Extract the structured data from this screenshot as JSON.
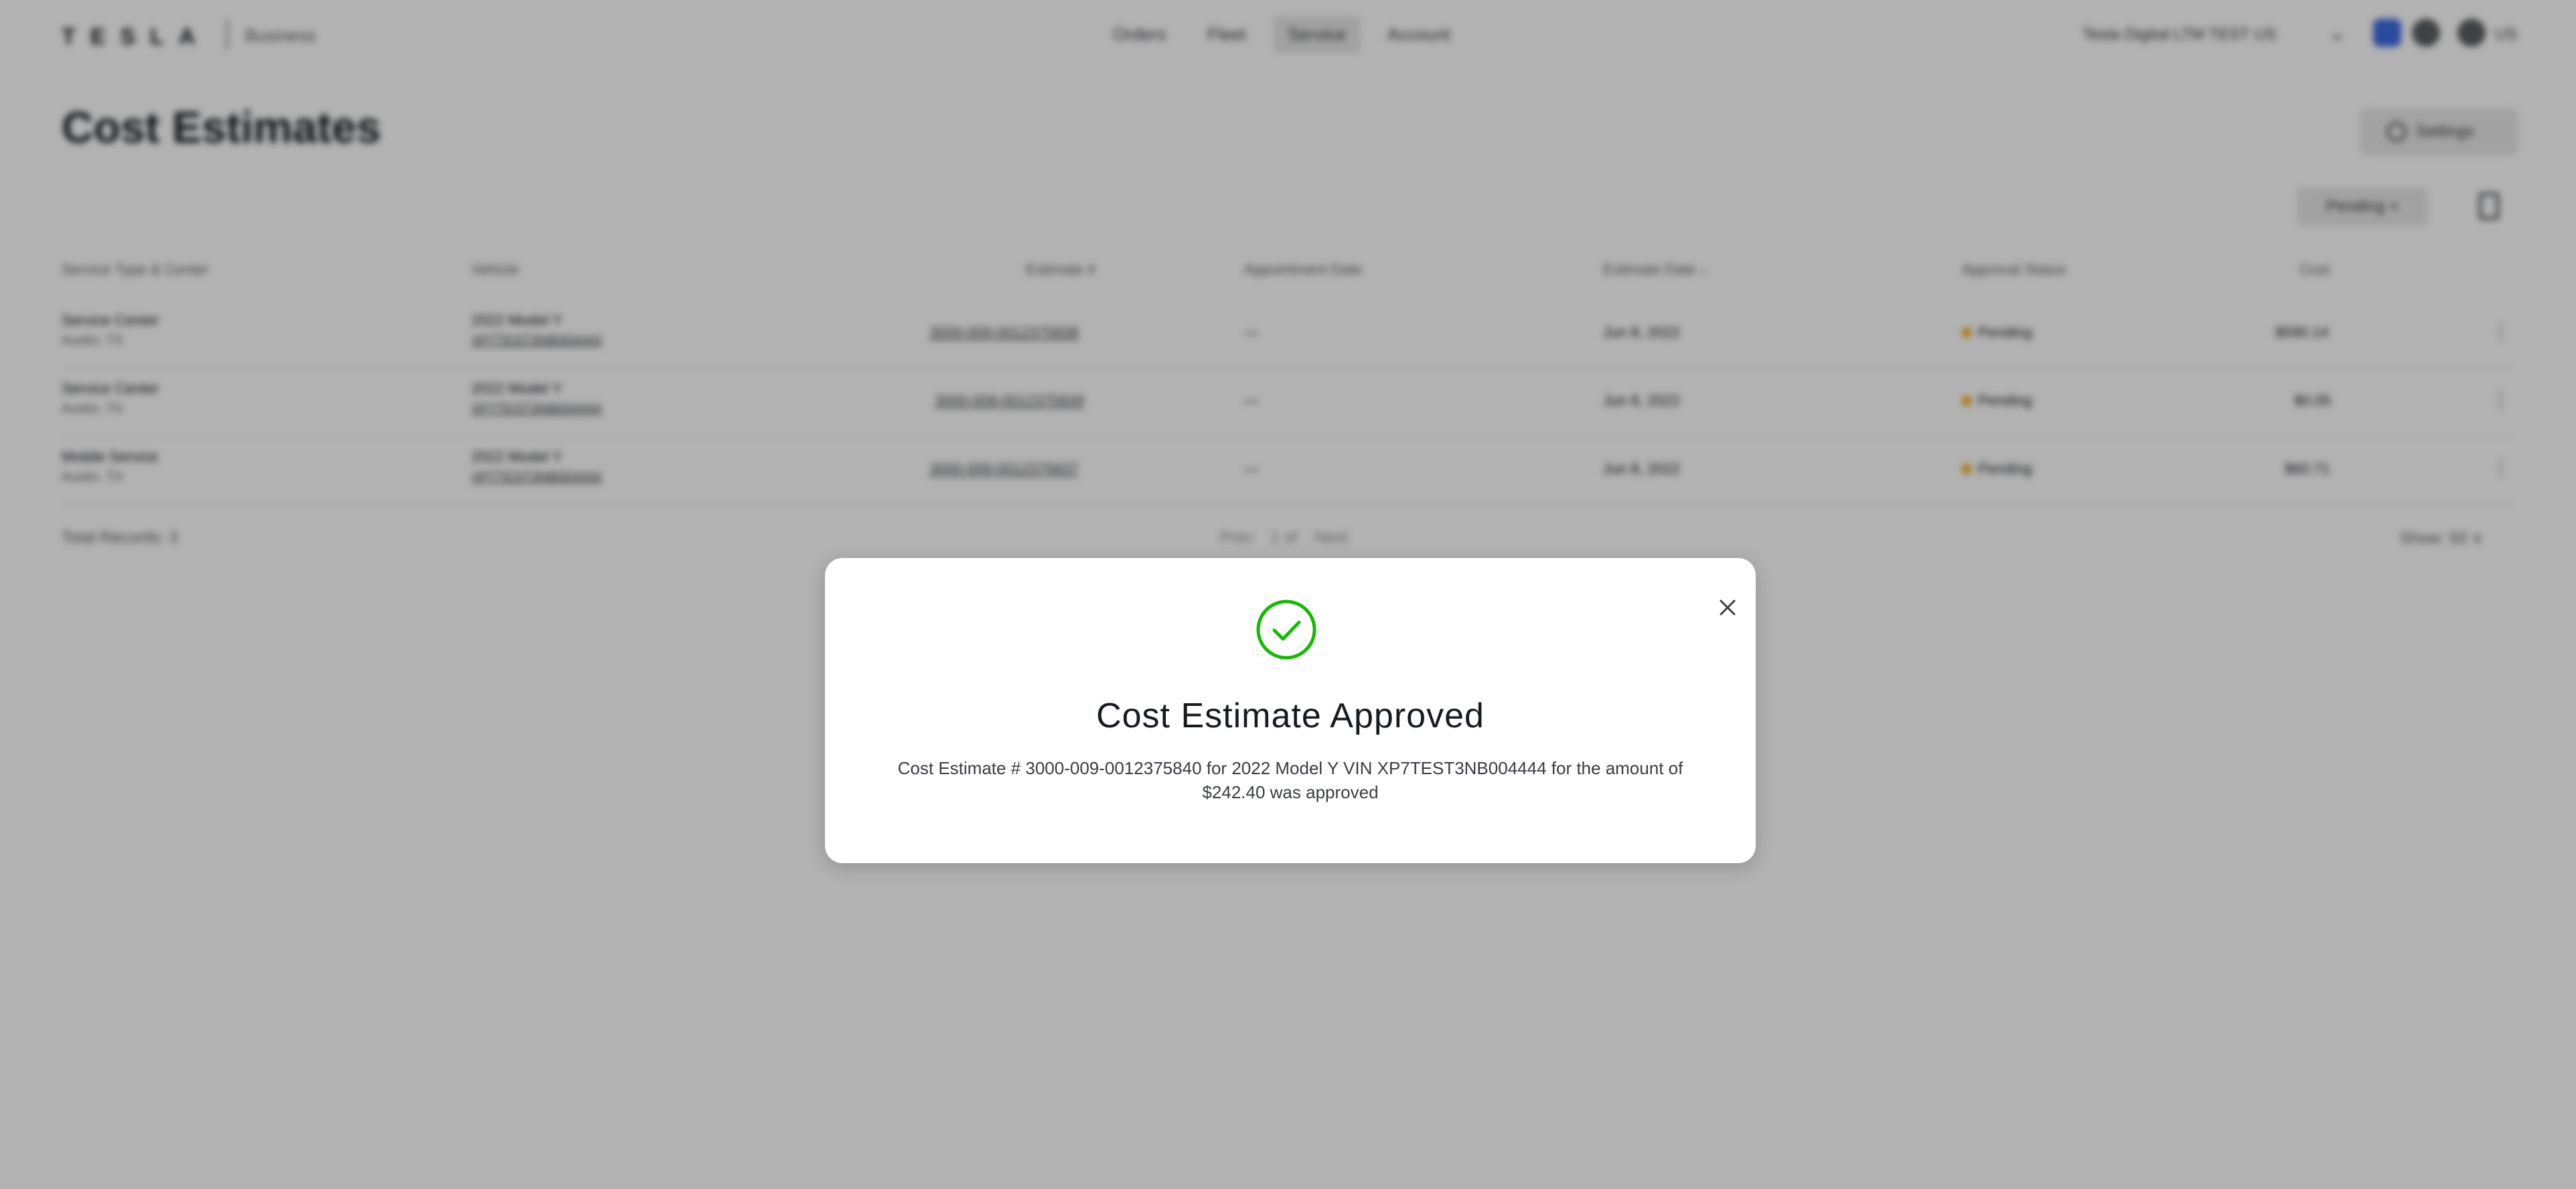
{
  "header": {
    "logo": "TESLA",
    "logo_sub": "Business",
    "nav": [
      "Orders",
      "Fleet",
      "Service",
      "Account"
    ],
    "active_nav": "Service",
    "account": "Tesla Digital LTM TEST US",
    "language": "US"
  },
  "page": {
    "title": "Cost Estimates",
    "settings_label": "Settings",
    "filter_label": "Pending ×"
  },
  "table": {
    "columns": [
      "Service Type & Center",
      "Vehicle",
      "Estimate #",
      "Appointment Date",
      "Estimate Date ↓",
      "Approval Status",
      "Cost"
    ],
    "rows": [
      {
        "service_type": "Service Center",
        "location": "Austin, TX",
        "vehicle": "2022 Model Y",
        "vin": "XP7TEST3NB004444",
        "estimate_no": "3000-009-0012375838",
        "appointment": "—",
        "estimate_date": "Jun 8, 2022",
        "status": "Pending",
        "cost": "$590.14"
      },
      {
        "service_type": "Service Center",
        "location": "Austin, TX",
        "vehicle": "2022 Model Y",
        "vin": "XP7TEST3NB004444",
        "estimate_no": "3000-009-0012375839",
        "appointment": "—",
        "estimate_date": "Jun 8, 2022",
        "status": "Pending",
        "cost": "$0.05"
      },
      {
        "service_type": "Mobile Service",
        "location": "Austin, TX",
        "vehicle": "2022 Model Y",
        "vin": "XP7TEST3NB004444",
        "estimate_no": "3000-009-0012375837",
        "appointment": "—",
        "estimate_date": "Jun 8, 2022",
        "status": "Pending",
        "cost": "$60.71"
      }
    ],
    "total_records": "Total Records: 3",
    "pager": {
      "prev": "Prev",
      "current": "1 of",
      "next": "Next"
    },
    "show": "Show: 50 ∨"
  },
  "modal": {
    "title": "Cost Estimate Approved",
    "message": "Cost Estimate # 3000-009-0012375840 for 2022 Model Y VIN XP7TEST3NB004444 for the amount of $242.40 was approved",
    "icon": "check-circle-icon",
    "close_icon": "close-icon",
    "success_color": "#12bb00"
  }
}
